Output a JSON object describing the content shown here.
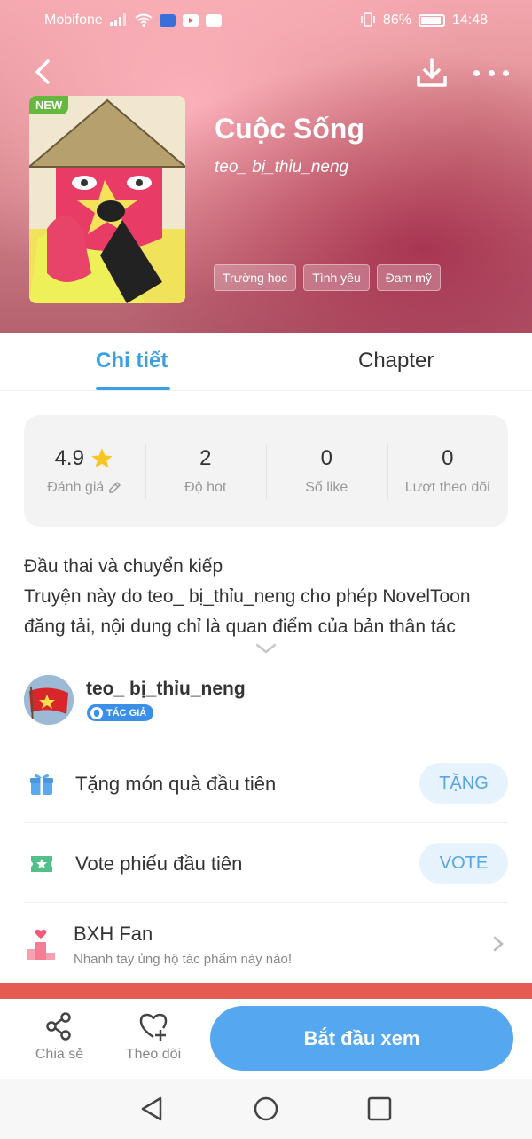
{
  "status_bar": {
    "carrier": "Mobifone",
    "battery": "86%",
    "time": "14:48"
  },
  "book": {
    "badge": "NEW",
    "title": "Cuộc Sống",
    "author": "teo_ bị_thỉu_neng",
    "tags": [
      "Trường học",
      "Tình yêu",
      "Đam mỹ"
    ]
  },
  "tabs": [
    {
      "label": "Chi tiết",
      "active": true
    },
    {
      "label": "Chapter",
      "active": false
    }
  ],
  "stats": [
    {
      "value": "4.9",
      "label": "Đánh giá"
    },
    {
      "value": "2",
      "label": "Độ hot"
    },
    {
      "value": "0",
      "label": "Số like"
    },
    {
      "value": "0",
      "label": "Lượt theo dõi"
    }
  ],
  "description": {
    "line1": "Đầu thai và chuyển kiếp",
    "line2": "Truyện này do teo_ bị_thỉu_neng cho phép NovelToon",
    "line3": "đăng tải, nội dung chỉ là quan điểm của bản thân tác"
  },
  "author_section": {
    "name": "teo_ bị_thỉu_neng",
    "badge": "TÁC GIẢ"
  },
  "actions": {
    "gift": {
      "label": "Tặng món quà đầu tiên",
      "button": "TẶNG"
    },
    "vote": {
      "label": "Vote phiếu đầu tiên",
      "button": "VOTE"
    },
    "fan": {
      "title": "BXH Fan",
      "subtitle": "Nhanh tay ủng hộ tác phẩm này nào!"
    }
  },
  "bottom_bar": {
    "share": "Chia sẻ",
    "follow": "Theo dõi",
    "start": "Bắt đầu xem"
  },
  "colors": {
    "accent": "#3aa0e3",
    "primary_button": "#55a8ef",
    "badge_green": "#64b83e",
    "strip_red": "#e55a52"
  }
}
